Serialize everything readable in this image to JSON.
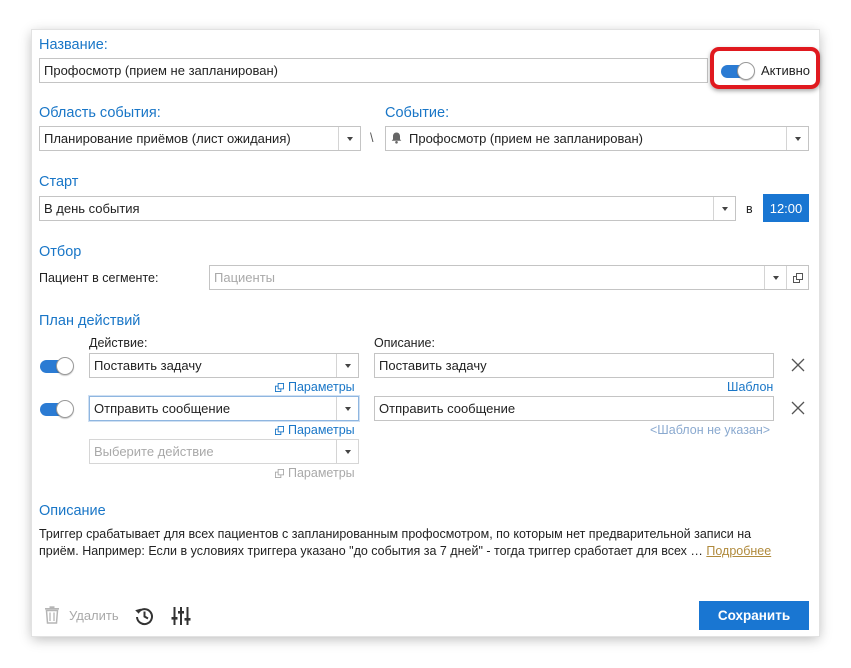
{
  "name_section": {
    "label": "Название:",
    "value": "Профосмотр (прием не запланирован)",
    "active_label": "Активно"
  },
  "event_area": {
    "label": "Область события:",
    "value": "Планирование приёмов (лист ожидания)"
  },
  "separator": "\\",
  "event": {
    "label": "Событие:",
    "value": "Профосмотр (прием не запланирован)"
  },
  "start": {
    "label": "Старт",
    "value": "В день события",
    "at_label": "в",
    "time": "12:00"
  },
  "filter": {
    "label": "Отбор",
    "segment_label": "Пациент в сегменте:",
    "segment_placeholder": "Пациенты"
  },
  "plan": {
    "label": "План действий",
    "action_header": "Действие:",
    "description_header": "Описание:",
    "rows": [
      {
        "action": "Поставить задачу",
        "params": "Параметры",
        "description": "Поставить задачу",
        "template": "Шаблон"
      },
      {
        "action": "Отправить сообщение",
        "params": "Параметры",
        "description": "Отправить сообщение",
        "template": "<Шаблон не указан>"
      }
    ],
    "new_action_placeholder": "Выберите действие",
    "new_params": "Параметры"
  },
  "description": {
    "label": "Описание",
    "text_line1": "Триггер срабатывает для всех пациентов с запланированным профосмотром, по которым нет предварительной записи на",
    "text_line2": "приём. Например: Если в условиях триггера указано \"до события за 7 дней\" - тогда триггер сработает для всех …",
    "more_link": "Подробнее"
  },
  "footer": {
    "delete_label": "Удалить",
    "save_label": "Сохранить"
  },
  "colors": {
    "accent": "#1976d2",
    "label_blue": "#1976c7",
    "highlight_red": "#e0191f",
    "more_link": "#b08a3c"
  }
}
